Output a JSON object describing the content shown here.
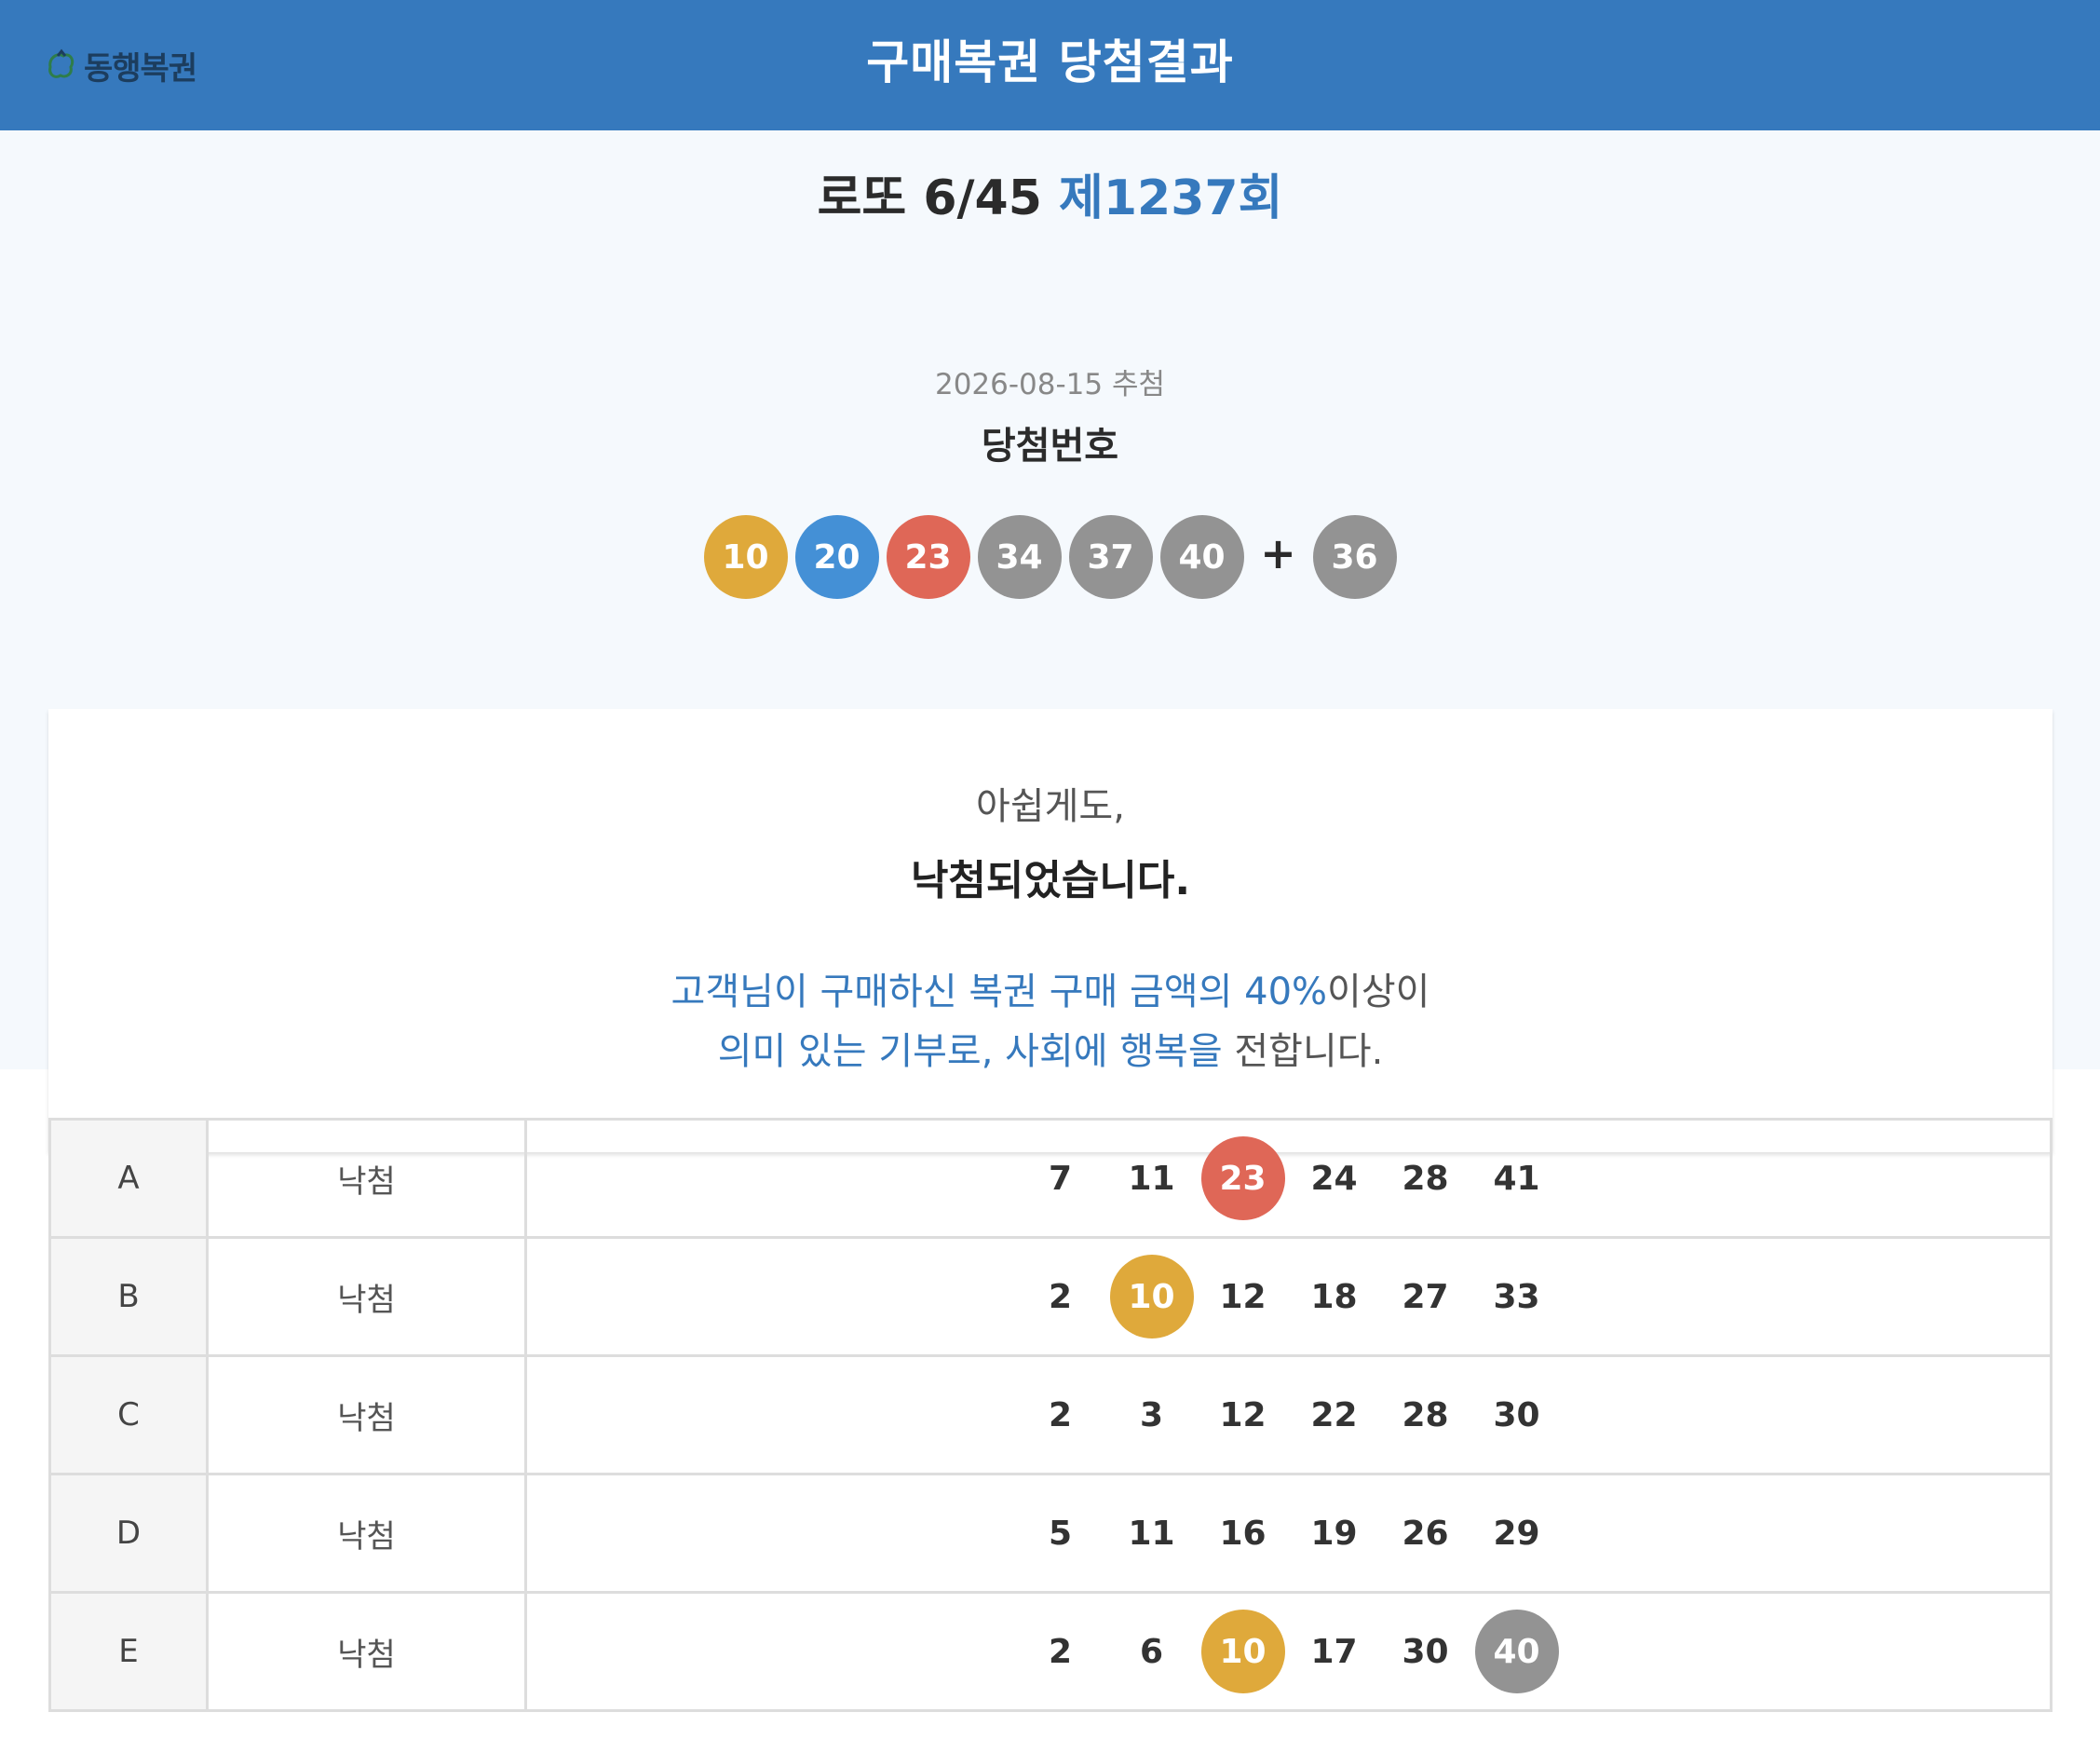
{
  "header": {
    "logo_text": "동행복권",
    "title": "구매복권 당첨결과"
  },
  "draw": {
    "game": "로또 6/45",
    "round": "제1237회",
    "date": "2026-08-15 추첨",
    "winning_label": "당첨번호",
    "numbers": [
      {
        "value": "10",
        "color": "#dfa93b"
      },
      {
        "value": "20",
        "color": "#4490d6"
      },
      {
        "value": "23",
        "color": "#df6757"
      },
      {
        "value": "34",
        "color": "#939393"
      },
      {
        "value": "37",
        "color": "#939393"
      },
      {
        "value": "40",
        "color": "#939393"
      }
    ],
    "plus": "+",
    "bonus": {
      "value": "36",
      "color": "#939393"
    }
  },
  "result": {
    "sub": "아쉽게도,",
    "main": "낙첨되었습니다.",
    "line1_highlight": "고객님이 구매하신 복권 구매 금액의 40%",
    "line1_rest": "이상이",
    "line2_highlight": "의미 있는 기부로, 사회에 행복을",
    "line2_rest": " 전합니다."
  },
  "tickets": [
    {
      "id": "A",
      "status": "낙첨",
      "numbers": [
        {
          "value": "7",
          "color": null
        },
        {
          "value": "11",
          "color": null
        },
        {
          "value": "23",
          "color": "#df6757"
        },
        {
          "value": "24",
          "color": null
        },
        {
          "value": "28",
          "color": null
        },
        {
          "value": "41",
          "color": null
        }
      ]
    },
    {
      "id": "B",
      "status": "낙첨",
      "numbers": [
        {
          "value": "2",
          "color": null
        },
        {
          "value": "10",
          "color": "#dfa93b"
        },
        {
          "value": "12",
          "color": null
        },
        {
          "value": "18",
          "color": null
        },
        {
          "value": "27",
          "color": null
        },
        {
          "value": "33",
          "color": null
        }
      ]
    },
    {
      "id": "C",
      "status": "낙첨",
      "numbers": [
        {
          "value": "2",
          "color": null
        },
        {
          "value": "3",
          "color": null
        },
        {
          "value": "12",
          "color": null
        },
        {
          "value": "22",
          "color": null
        },
        {
          "value": "28",
          "color": null
        },
        {
          "value": "30",
          "color": null
        }
      ]
    },
    {
      "id": "D",
      "status": "낙첨",
      "numbers": [
        {
          "value": "5",
          "color": null
        },
        {
          "value": "11",
          "color": null
        },
        {
          "value": "16",
          "color": null
        },
        {
          "value": "19",
          "color": null
        },
        {
          "value": "26",
          "color": null
        },
        {
          "value": "29",
          "color": null
        }
      ]
    },
    {
      "id": "E",
      "status": "낙첨",
      "numbers": [
        {
          "value": "2",
          "color": null
        },
        {
          "value": "6",
          "color": null
        },
        {
          "value": "10",
          "color": "#dfa93b"
        },
        {
          "value": "17",
          "color": null
        },
        {
          "value": "30",
          "color": null
        },
        {
          "value": "40",
          "color": "#939393"
        }
      ]
    }
  ],
  "colors": {
    "header_bg": "#3679bd",
    "accent": "#3679bd",
    "page_bg": "#f5f9fd"
  }
}
